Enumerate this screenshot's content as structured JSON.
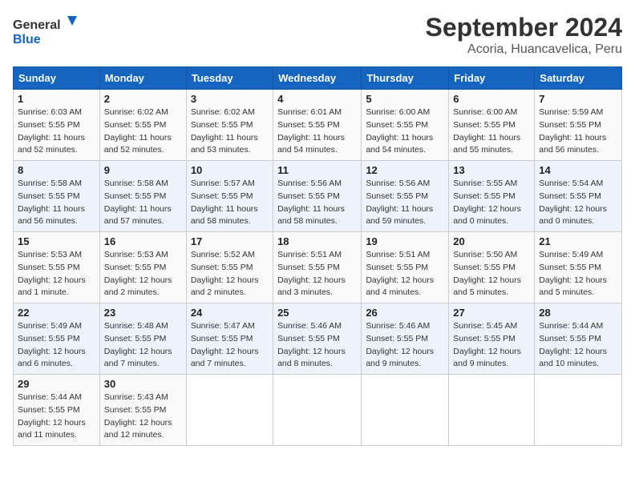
{
  "header": {
    "logo_line1": "General",
    "logo_line2": "Blue",
    "month": "September 2024",
    "location": "Acoria, Huancavelica, Peru"
  },
  "days_of_week": [
    "Sunday",
    "Monday",
    "Tuesday",
    "Wednesday",
    "Thursday",
    "Friday",
    "Saturday"
  ],
  "weeks": [
    [
      {
        "day": 1,
        "sunrise": "6:03 AM",
        "sunset": "5:55 PM",
        "daylight": "11 hours and 52 minutes."
      },
      {
        "day": 2,
        "sunrise": "6:02 AM",
        "sunset": "5:55 PM",
        "daylight": "11 hours and 52 minutes."
      },
      {
        "day": 3,
        "sunrise": "6:02 AM",
        "sunset": "5:55 PM",
        "daylight": "11 hours and 53 minutes."
      },
      {
        "day": 4,
        "sunrise": "6:01 AM",
        "sunset": "5:55 PM",
        "daylight": "11 hours and 54 minutes."
      },
      {
        "day": 5,
        "sunrise": "6:00 AM",
        "sunset": "5:55 PM",
        "daylight": "11 hours and 54 minutes."
      },
      {
        "day": 6,
        "sunrise": "6:00 AM",
        "sunset": "5:55 PM",
        "daylight": "11 hours and 55 minutes."
      },
      {
        "day": 7,
        "sunrise": "5:59 AM",
        "sunset": "5:55 PM",
        "daylight": "11 hours and 56 minutes."
      }
    ],
    [
      {
        "day": 8,
        "sunrise": "5:58 AM",
        "sunset": "5:55 PM",
        "daylight": "11 hours and 56 minutes."
      },
      {
        "day": 9,
        "sunrise": "5:58 AM",
        "sunset": "5:55 PM",
        "daylight": "11 hours and 57 minutes."
      },
      {
        "day": 10,
        "sunrise": "5:57 AM",
        "sunset": "5:55 PM",
        "daylight": "11 hours and 58 minutes."
      },
      {
        "day": 11,
        "sunrise": "5:56 AM",
        "sunset": "5:55 PM",
        "daylight": "11 hours and 58 minutes."
      },
      {
        "day": 12,
        "sunrise": "5:56 AM",
        "sunset": "5:55 PM",
        "daylight": "11 hours and 59 minutes."
      },
      {
        "day": 13,
        "sunrise": "5:55 AM",
        "sunset": "5:55 PM",
        "daylight": "12 hours and 0 minutes."
      },
      {
        "day": 14,
        "sunrise": "5:54 AM",
        "sunset": "5:55 PM",
        "daylight": "12 hours and 0 minutes."
      }
    ],
    [
      {
        "day": 15,
        "sunrise": "5:53 AM",
        "sunset": "5:55 PM",
        "daylight": "12 hours and 1 minute."
      },
      {
        "day": 16,
        "sunrise": "5:53 AM",
        "sunset": "5:55 PM",
        "daylight": "12 hours and 2 minutes."
      },
      {
        "day": 17,
        "sunrise": "5:52 AM",
        "sunset": "5:55 PM",
        "daylight": "12 hours and 2 minutes."
      },
      {
        "day": 18,
        "sunrise": "5:51 AM",
        "sunset": "5:55 PM",
        "daylight": "12 hours and 3 minutes."
      },
      {
        "day": 19,
        "sunrise": "5:51 AM",
        "sunset": "5:55 PM",
        "daylight": "12 hours and 4 minutes."
      },
      {
        "day": 20,
        "sunrise": "5:50 AM",
        "sunset": "5:55 PM",
        "daylight": "12 hours and 5 minutes."
      },
      {
        "day": 21,
        "sunrise": "5:49 AM",
        "sunset": "5:55 PM",
        "daylight": "12 hours and 5 minutes."
      }
    ],
    [
      {
        "day": 22,
        "sunrise": "5:49 AM",
        "sunset": "5:55 PM",
        "daylight": "12 hours and 6 minutes."
      },
      {
        "day": 23,
        "sunrise": "5:48 AM",
        "sunset": "5:55 PM",
        "daylight": "12 hours and 7 minutes."
      },
      {
        "day": 24,
        "sunrise": "5:47 AM",
        "sunset": "5:55 PM",
        "daylight": "12 hours and 7 minutes."
      },
      {
        "day": 25,
        "sunrise": "5:46 AM",
        "sunset": "5:55 PM",
        "daylight": "12 hours and 8 minutes."
      },
      {
        "day": 26,
        "sunrise": "5:46 AM",
        "sunset": "5:55 PM",
        "daylight": "12 hours and 9 minutes."
      },
      {
        "day": 27,
        "sunrise": "5:45 AM",
        "sunset": "5:55 PM",
        "daylight": "12 hours and 9 minutes."
      },
      {
        "day": 28,
        "sunrise": "5:44 AM",
        "sunset": "5:55 PM",
        "daylight": "12 hours and 10 minutes."
      }
    ],
    [
      {
        "day": 29,
        "sunrise": "5:44 AM",
        "sunset": "5:55 PM",
        "daylight": "12 hours and 11 minutes."
      },
      {
        "day": 30,
        "sunrise": "5:43 AM",
        "sunset": "5:55 PM",
        "daylight": "12 hours and 12 minutes."
      },
      null,
      null,
      null,
      null,
      null
    ]
  ]
}
